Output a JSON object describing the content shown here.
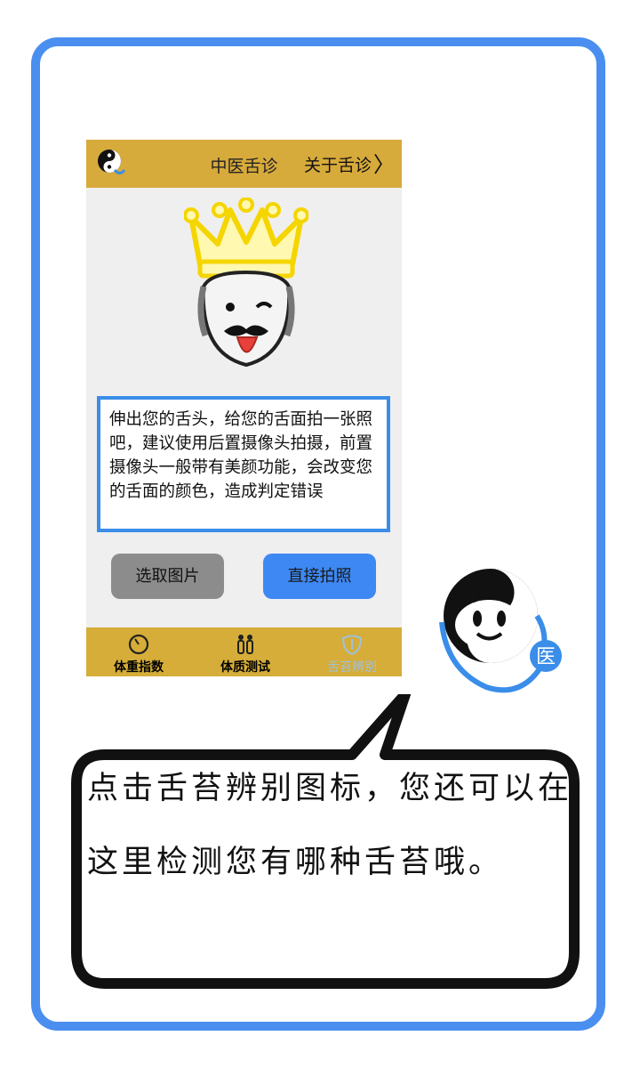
{
  "app": {
    "title": "中医舌诊",
    "about_label": "关于舌诊",
    "logo_icon": "yin-yang-doctor-logo-icon",
    "accent_color": "#d7aa3c",
    "highlight_color": "#3a8de9"
  },
  "instruction": {
    "text": "伸出您的舌头，给您的舌面拍一张照吧，建议使用后置摄像头拍摄，前置摄像头一般带有美颜功能，会改变您的舌面的颜色，造成判定错误"
  },
  "buttons": {
    "choose_photo": "选取图片",
    "take_photo": "直接拍照"
  },
  "nav": {
    "items": [
      {
        "label": "体重指数",
        "icon": "gauge-icon",
        "active": false
      },
      {
        "label": "体质测试",
        "icon": "people-icon",
        "active": false
      },
      {
        "label": "舌苔辨别",
        "icon": "tongue-shield-icon",
        "active": true
      }
    ]
  },
  "mascot": {
    "badge_label": "医"
  },
  "bubble": {
    "text": "点击舌苔辨别图标，您还可以在这里检测您有哪种舌苔哦。"
  }
}
